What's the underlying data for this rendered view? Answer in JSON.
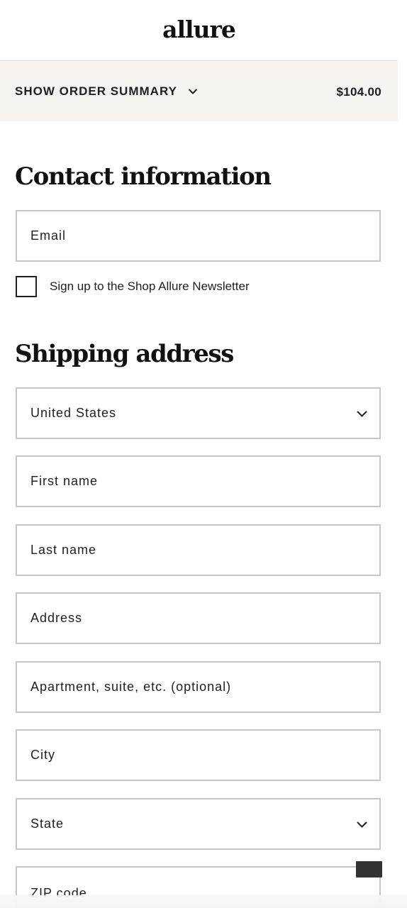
{
  "brand": {
    "logo_text": "allure"
  },
  "order_summary": {
    "toggle_label": "SHOW ORDER SUMMARY",
    "toggle_icon": "chevron-down-icon",
    "total": "$104.00"
  },
  "contact": {
    "title": "Contact information",
    "email_placeholder": "Email",
    "newsletter_label": "Sign up to the Shop Allure Newsletter",
    "newsletter_checked": false
  },
  "shipping": {
    "title": "Shipping address",
    "country": {
      "value": "United States",
      "icon": "chevron-down-icon"
    },
    "first_name_placeholder": "First name",
    "last_name_placeholder": "Last name",
    "address_placeholder": "Address",
    "apartment_placeholder": "Apartment, suite, etc. (optional)",
    "city_placeholder": "City",
    "state": {
      "value": "State",
      "icon": "chevron-down-icon"
    },
    "zip_placeholder": "ZIP code"
  }
}
